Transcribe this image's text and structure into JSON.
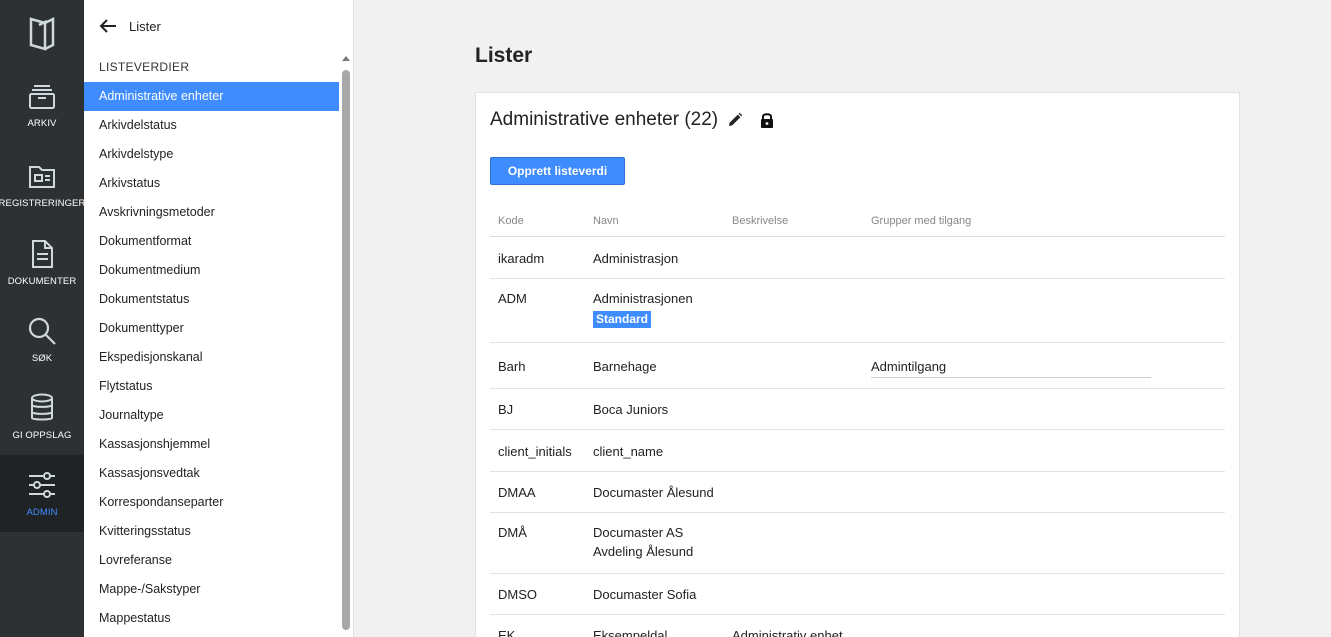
{
  "rail": {
    "items": [
      {
        "label": "ARKIV",
        "icon": "archive-box-icon"
      },
      {
        "label": "REGISTRERINGER",
        "icon": "folder-card-icon"
      },
      {
        "label": "DOKUMENTER",
        "icon": "document-icon"
      },
      {
        "label": "SØK",
        "icon": "search-icon"
      },
      {
        "label": "GI OPPSLAG",
        "icon": "database-icon"
      },
      {
        "label": "ADMIN",
        "icon": "sliders-icon",
        "active": true
      }
    ]
  },
  "panel": {
    "title": "Lister",
    "section_label": "LISTEVERDIER",
    "items": [
      "Administrative enheter",
      "Arkivdelstatus",
      "Arkivdelstype",
      "Arkivstatus",
      "Avskrivningsmetoder",
      "Dokumentformat",
      "Dokumentmedium",
      "Dokumentstatus",
      "Dokumenttyper",
      "Ekspedisjonskanal",
      "Flytstatus",
      "Journaltype",
      "Kassasjonshjemmel",
      "Kassasjonsvedtak",
      "Korrespondanseparter",
      "Kvitteringsstatus",
      "Lovreferanse",
      "Mappe-/Sakstyper",
      "Mappestatus"
    ],
    "selected_index": 0
  },
  "main": {
    "title": "Lister",
    "card_title": "Administrative enheter (22)",
    "create_button": "Opprett listeverdi",
    "columns": [
      "Kode",
      "Navn",
      "Beskrivelse",
      "Grupper med tilgang"
    ],
    "rows": [
      {
        "kode": "ikaradm",
        "navn": "Administrasjon",
        "navn2": "",
        "badge": "",
        "beskrivelse": "",
        "grupper": ""
      },
      {
        "kode": "ADM",
        "navn": "Administrasjonen",
        "navn2": "",
        "badge": "Standard",
        "beskrivelse": "",
        "grupper": ""
      },
      {
        "kode": "Barh",
        "navn": "Barnehage",
        "navn2": "",
        "badge": "",
        "beskrivelse": "",
        "grupper": "Admintilgang"
      },
      {
        "kode": "BJ",
        "navn": "Boca Juniors",
        "navn2": "",
        "badge": "",
        "beskrivelse": "",
        "grupper": ""
      },
      {
        "kode": "client_initials",
        "navn": "client_name",
        "navn2": "",
        "badge": "",
        "beskrivelse": "",
        "grupper": ""
      },
      {
        "kode": "DMAA",
        "navn": "Documaster Ålesund",
        "navn2": "",
        "badge": "",
        "beskrivelse": "",
        "grupper": ""
      },
      {
        "kode": "DMÅ",
        "navn": "Documaster AS",
        "navn2": "Avdeling Ålesund",
        "badge": "",
        "beskrivelse": "",
        "grupper": ""
      },
      {
        "kode": "DMSO",
        "navn": "Documaster Sofia",
        "navn2": "",
        "badge": "",
        "beskrivelse": "",
        "grupper": ""
      },
      {
        "kode": "EK",
        "navn": "Eksempeldal",
        "navn2": "",
        "badge": "",
        "beskrivelse": "Administrativ enhet",
        "grupper": ""
      }
    ]
  },
  "colors": {
    "accent": "#3f8cff",
    "rail": "#2d3134"
  }
}
